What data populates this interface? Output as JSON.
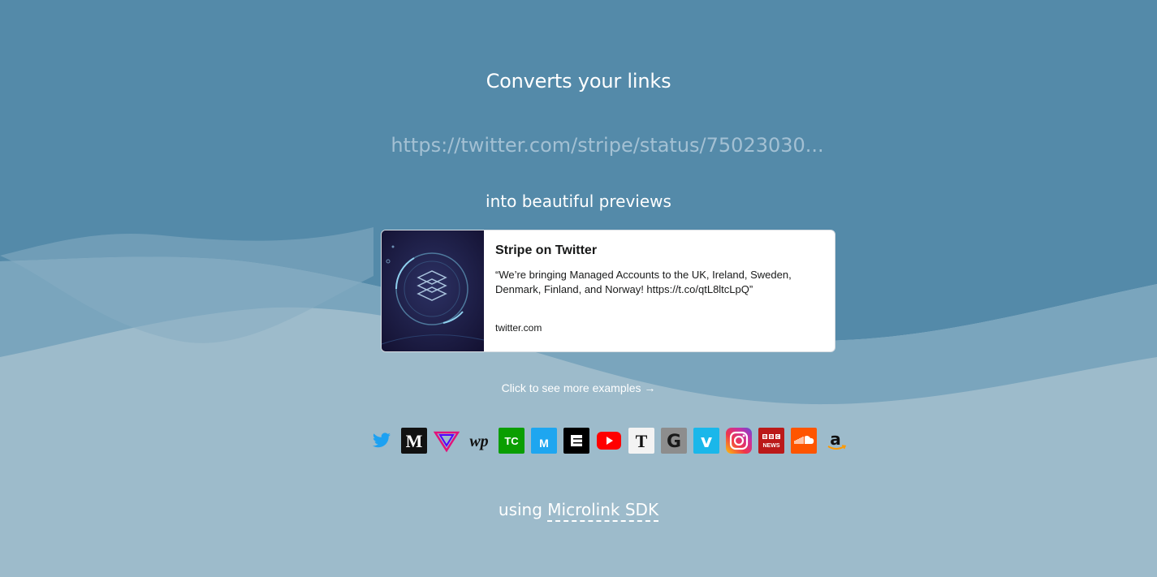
{
  "hero": {
    "title": "Converts your links",
    "url_value": "https://twitter.com/stripe/status/75023030...",
    "subtitle": "into beautiful previews"
  },
  "card": {
    "title": "Stripe on Twitter",
    "description": "“We’re bringing Managed Accounts to the UK, Ireland, Sweden, Denmark, Finland, and Norway! https://t.co/qtL8ltcLpQ”",
    "url": "twitter.com"
  },
  "examples": {
    "label": "Click to see more examples →"
  },
  "logos": [
    {
      "name": "twitter",
      "text": ""
    },
    {
      "name": "medium",
      "text": "M"
    },
    {
      "name": "verge",
      "text": ""
    },
    {
      "name": "washington-post",
      "text": "wp"
    },
    {
      "name": "techcrunch",
      "text": "TC"
    },
    {
      "name": "meetup",
      "text": "M"
    },
    {
      "name": "engadget",
      "text": "e"
    },
    {
      "name": "youtube",
      "text": ""
    },
    {
      "name": "new-york-times",
      "text": "T"
    },
    {
      "name": "google",
      "text": "G"
    },
    {
      "name": "vimeo",
      "text": "v"
    },
    {
      "name": "instagram",
      "text": ""
    },
    {
      "name": "bbc-news",
      "text": "BBC NEWS"
    },
    {
      "name": "soundcloud",
      "text": ""
    },
    {
      "name": "amazon",
      "text": "a"
    }
  ],
  "footer": {
    "prefix": "using",
    "link_label": "Microlink SDK"
  },
  "colors": {
    "top_background": "#548aa9",
    "bottom_background": "#9dbbcb",
    "mid_wave": "#7aa5bd"
  }
}
